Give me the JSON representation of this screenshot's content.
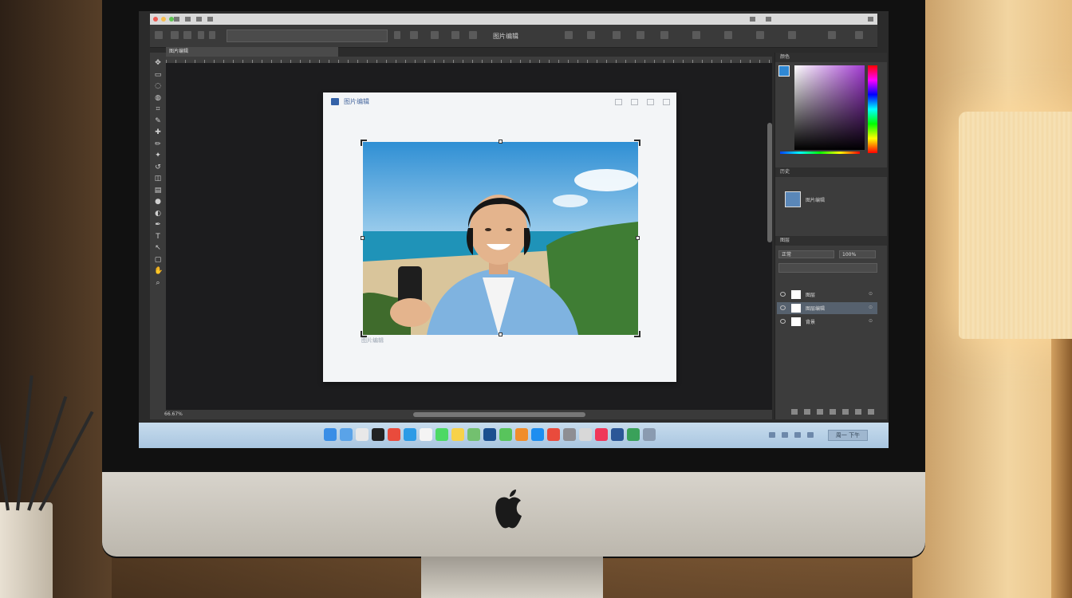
{
  "app": {
    "window_title": "图片编辑",
    "tab_label": "图片编辑"
  },
  "document": {
    "title": "图片编辑",
    "caption": "图片编辑",
    "photo_subject": "smiling person holding phone on beach"
  },
  "panels": {
    "color": {
      "header": "颜色",
      "foreground": "#2f88d4"
    },
    "history": {
      "header": "历史",
      "item_label": "图片编辑"
    },
    "layers": {
      "header": "图层",
      "blend_mode": "正常",
      "opacity": "100%",
      "layers": [
        {
          "name": "图层",
          "selected": false
        },
        {
          "name": "图层编辑",
          "selected": true
        },
        {
          "name": "背景",
          "selected": false
        }
      ]
    }
  },
  "status": {
    "text": "66.67%"
  },
  "toolbar": {
    "tools": [
      "move-tool-icon",
      "marquee-tool-icon",
      "lasso-tool-icon",
      "quick-select-tool-icon",
      "crop-tool-icon",
      "eyedropper-tool-icon",
      "healing-tool-icon",
      "brush-tool-icon",
      "stamp-tool-icon",
      "history-brush-icon",
      "eraser-tool-icon",
      "gradient-tool-icon",
      "blur-tool-icon",
      "dodge-tool-icon",
      "pen-tool-icon",
      "type-tool-icon",
      "path-select-icon",
      "shape-tool-icon",
      "hand-tool-icon",
      "zoom-tool-icon"
    ]
  },
  "dock": {
    "icons": [
      "finder-icon",
      "mail-icon",
      "photos-icon",
      "terminal-icon",
      "chrome-icon",
      "safari-icon",
      "calendar-icon",
      "messages-icon",
      "notes-icon",
      "maps-icon",
      "photoshop-icon",
      "facetime-icon",
      "books-icon",
      "appstore-icon",
      "chrome-icon",
      "system-prefs-icon",
      "launchpad-icon",
      "music-icon",
      "word-icon",
      "numbers-icon",
      "trash-icon"
    ],
    "clock": "周一 下午"
  }
}
